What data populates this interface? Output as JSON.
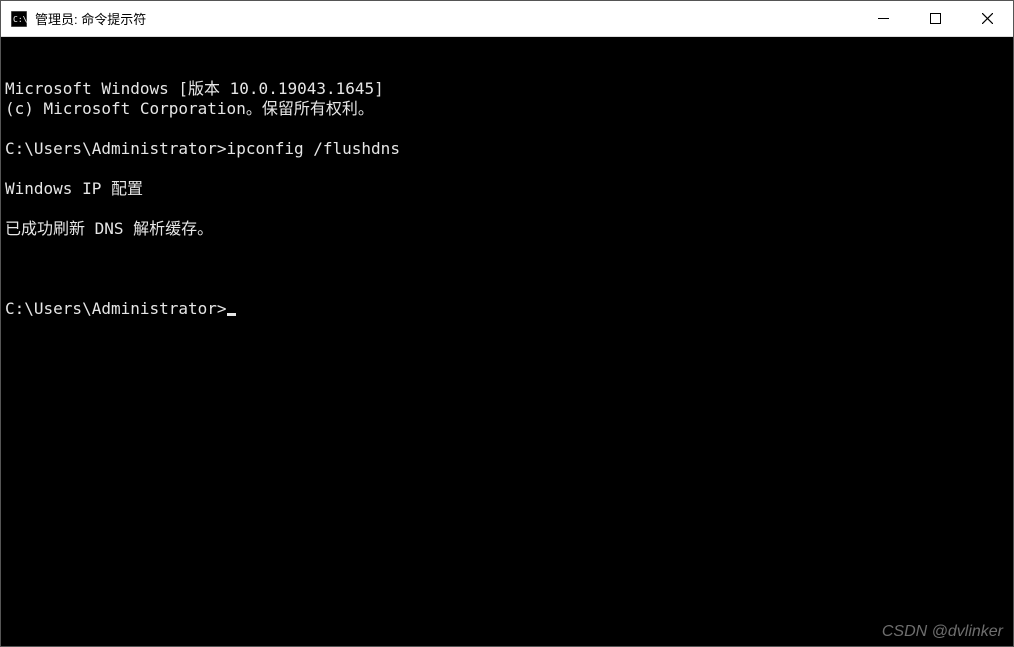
{
  "window": {
    "title": "管理员: 命令提示符"
  },
  "terminal": {
    "lines": [
      "Microsoft Windows [版本 10.0.19043.1645]",
      "(c) Microsoft Corporation。保留所有权利。",
      "",
      "C:\\Users\\Administrator>ipconfig /flushdns",
      "",
      "Windows IP 配置",
      "",
      "已成功刷新 DNS 解析缓存。",
      ""
    ],
    "prompt": "C:\\Users\\Administrator>"
  },
  "watermark": "CSDN @dvlinker"
}
